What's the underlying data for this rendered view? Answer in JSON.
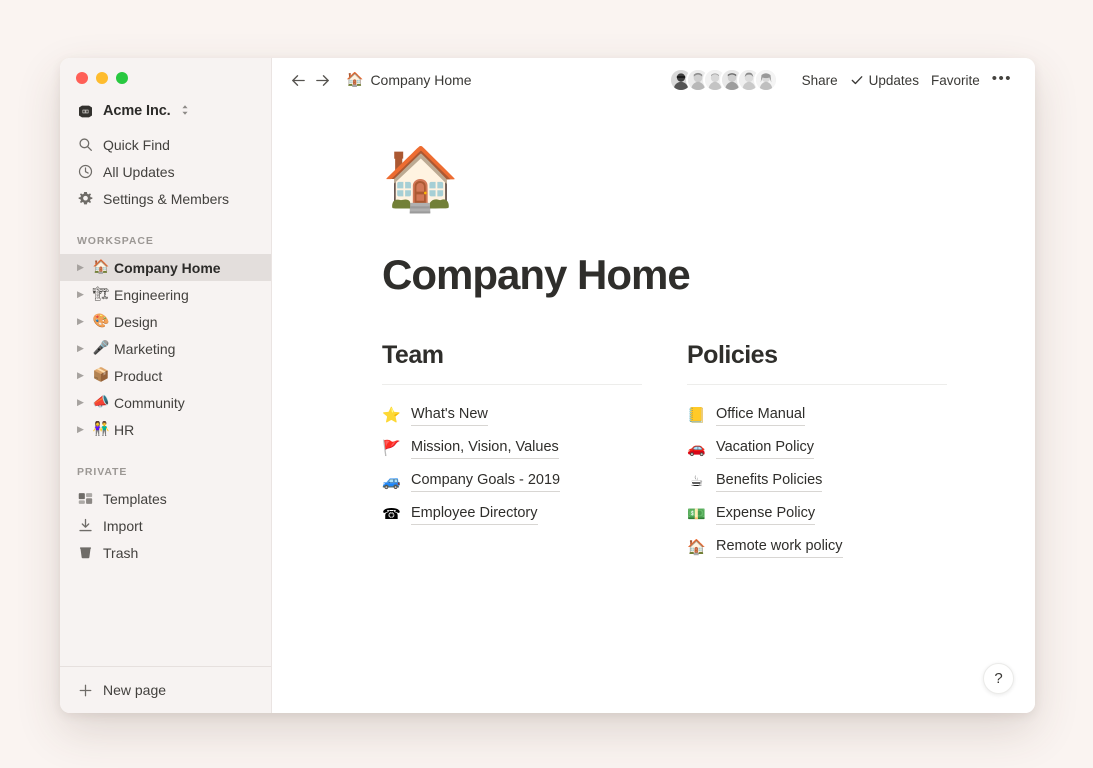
{
  "window": {
    "traffic_lights": [
      {
        "name": "close",
        "color": "#ff5f57"
      },
      {
        "name": "minimize",
        "color": "#febc2e"
      },
      {
        "name": "maximize",
        "color": "#28c840"
      }
    ]
  },
  "sidebar": {
    "workspace_switcher": {
      "name": "Acme Inc.",
      "icon": "workspace-logo-icon",
      "chevron": "⌃⌄"
    },
    "nav": [
      {
        "label": "Quick Find",
        "icon": "search-icon"
      },
      {
        "label": "All Updates",
        "icon": "clock-icon"
      },
      {
        "label": "Settings & Members",
        "icon": "gear-icon"
      }
    ],
    "workspace_section_label": "WORKSPACE",
    "workspace_pages": [
      {
        "label": "Company Home",
        "emoji": "🏠",
        "selected": true
      },
      {
        "label": "Engineering",
        "emoji": "🏗",
        "selected": false
      },
      {
        "label": "Design",
        "emoji": "🎨",
        "selected": false
      },
      {
        "label": "Marketing",
        "emoji": "🎤",
        "selected": false
      },
      {
        "label": "Product",
        "emoji": "📦",
        "selected": false
      },
      {
        "label": "Community",
        "emoji": "📣",
        "selected": false
      },
      {
        "label": "HR",
        "emoji": "👫",
        "selected": false
      }
    ],
    "private_section_label": "PRIVATE",
    "private_items": [
      {
        "label": "Templates",
        "icon": "templates-icon"
      },
      {
        "label": "Import",
        "icon": "import-icon"
      },
      {
        "label": "Trash",
        "icon": "trash-icon"
      }
    ],
    "footer": {
      "label": "New page",
      "icon": "plus-icon"
    }
  },
  "topbar": {
    "back_icon": "arrow-left-icon",
    "forward_icon": "arrow-right-icon",
    "breadcrumb": {
      "emoji": "🏠",
      "label": "Company Home"
    },
    "avatar_count": 6,
    "share_label": "Share",
    "updates_label": "Updates",
    "updates_icon": "check-icon",
    "favorite_label": "Favorite",
    "more_icon": "ellipsis-icon",
    "more_label": "•••"
  },
  "page": {
    "icon": "🏠",
    "title": "Company Home",
    "columns": [
      {
        "heading": "Team",
        "links": [
          {
            "emoji": "⭐",
            "label": "What's New"
          },
          {
            "emoji": "🚩",
            "label": "Mission, Vision, Values"
          },
          {
            "emoji": "🚙",
            "label": "Company Goals - 2019"
          },
          {
            "emoji": "☎",
            "label": "Employee Directory"
          }
        ]
      },
      {
        "heading": "Policies",
        "links": [
          {
            "emoji": "📒",
            "label": "Office Manual"
          },
          {
            "emoji": "🚗",
            "label": "Vacation Policy"
          },
          {
            "emoji": "☕",
            "label": "Benefits Policies"
          },
          {
            "emoji": "💵",
            "label": "Expense Policy"
          },
          {
            "emoji": "🏠",
            "label": "Remote work policy"
          }
        ]
      }
    ]
  },
  "help_button": {
    "label": "?"
  }
}
